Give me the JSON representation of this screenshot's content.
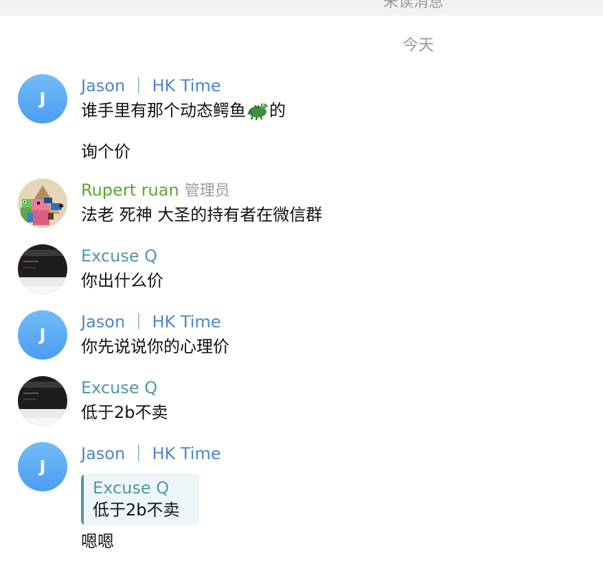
{
  "header": {
    "unread_label": "未读消息",
    "date_separator": "今天"
  },
  "colors": {
    "jason_name": "#4e86c8",
    "rupert_name": "#5aa636",
    "excuse_name": "#4f96a8",
    "avatar_gradient_top": "#72bdf7",
    "avatar_gradient_bottom": "#4c9cf2"
  },
  "messages": [
    {
      "sender": "Jason ｜ HK Time",
      "avatar_initial": "J",
      "lines": [
        "谁手里有那个动态鳄鱼",
        "的",
        "询个价"
      ],
      "emoji": "crocodile"
    },
    {
      "sender": "Rupert ruan",
      "role": "管理员",
      "text": "法老 死神 大圣的持有者在微信群"
    },
    {
      "sender": "Excuse Q",
      "text": "你出什么价"
    },
    {
      "sender": "Jason ｜ HK Time",
      "avatar_initial": "J",
      "text": "你先说说你的心理价"
    },
    {
      "sender": "Excuse Q",
      "text": "低于2b不卖"
    },
    {
      "sender": "Jason ｜ HK Time",
      "avatar_initial": "J",
      "reply": {
        "sender": "Excuse Q",
        "text": "低于2b不卖"
      },
      "text": "嗯嗯"
    }
  ]
}
